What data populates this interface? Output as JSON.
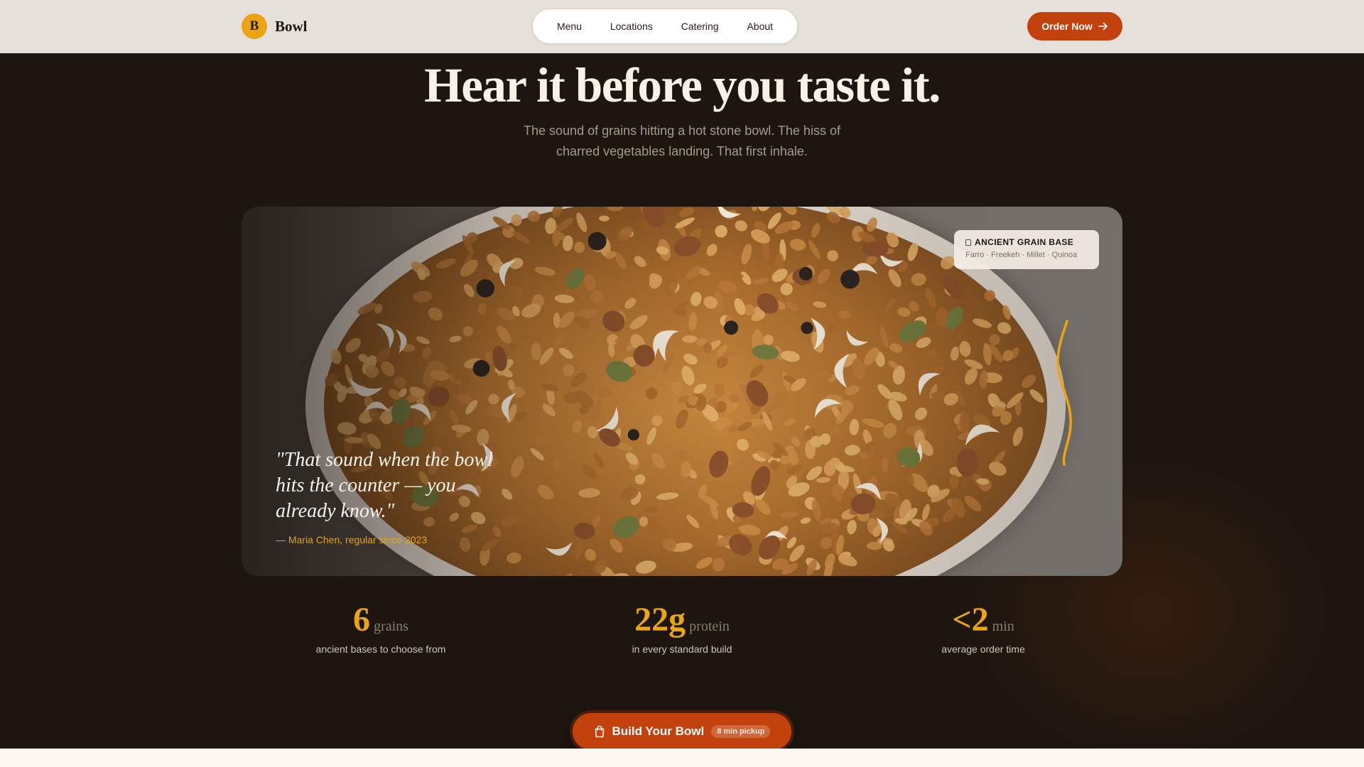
{
  "header": {
    "brand_initial": "B",
    "brand_name": "Bowl",
    "nav": [
      "Menu",
      "Locations",
      "Catering",
      "About"
    ],
    "cta_label": "Order Now",
    "cta_icon": "arrow-right-icon"
  },
  "hero": {
    "title": "Hear it before you taste it.",
    "subtitle": "The sound of grains hitting a hot stone bowl. The hiss of charred vegetables landing. That first inhale."
  },
  "feature_card": {
    "image": "granola-bowl-photo",
    "tag_title": "ANCIENT GRAIN BASE",
    "tag_items": "Farro · Freekeh · Millet · Quinoa",
    "quote": "\"That sound when the bowl hits the counter — you already know.\"",
    "quote_author": "— Maria Chen, regular since 2023"
  },
  "stats": [
    {
      "value": "6",
      "unit": "grains",
      "caption": "ancient bases to choose from"
    },
    {
      "value": "22g",
      "unit": "protein",
      "caption": "in every standard build"
    },
    {
      "value": "<2",
      "unit": "min",
      "caption": "average order time"
    }
  ],
  "cta": {
    "label": "Build Your Bowl",
    "badge": "8 min pickup",
    "icon": "shopping-bag-icon"
  },
  "colors": {
    "accent": "#c2410c",
    "gold": "#eba414",
    "background": "#1d150f",
    "header_bg": "#e6e0da"
  }
}
